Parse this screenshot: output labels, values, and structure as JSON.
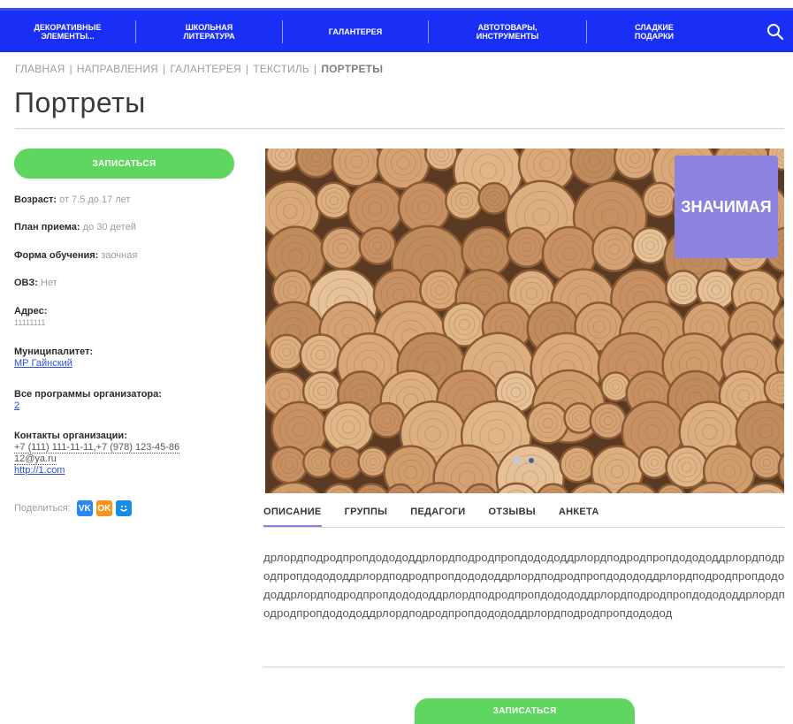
{
  "nav": {
    "items": [
      {
        "label": "Декоративные элементы..."
      },
      {
        "label": "Школьная литература"
      },
      {
        "label": "Галантерея"
      },
      {
        "label": "Автотовары, инструменты"
      },
      {
        "label": "Сладкие подарки"
      }
    ],
    "search_icon": "search-icon"
  },
  "breadcrumb": {
    "items": [
      "ГЛАВНАЯ",
      "НАПРАВЛЕНИЯ",
      "ГАЛАНТЕРЕЯ",
      "ТЕКСТИЛЬ"
    ],
    "current": "ПОРТРЕТЫ",
    "separator": "|"
  },
  "page": {
    "title": "Портреты"
  },
  "buttons": {
    "enroll_top": "ЗАПИСАТЬСЯ",
    "enroll_bottom": "ЗАПИСАТЬСЯ"
  },
  "info": {
    "age_label": "Возраст:",
    "age_value": "от 7.5 до 17 лет",
    "plan_label": "План приема:",
    "plan_value": "до 30 детей",
    "form_label": "Форма обучения:",
    "form_value": "заочная",
    "ovz_label": "ОВЗ:",
    "ovz_value": "Нет",
    "address_label": "Адрес:",
    "address_value": "11111111",
    "municipality_label": "Муниципалитет:",
    "municipality_value": "МР Гайнский",
    "programs_label": "Все программы организатора:",
    "programs_value": "2",
    "contacts_label": "Контакты организации:",
    "contacts_phone": "+7 (111) 111-11-11,+7 (978) 123-45-86",
    "contacts_email": "12@ya.ru",
    "contacts_site": "http://1.com"
  },
  "share": {
    "label": "Поделиться:",
    "vk": "VK",
    "ok": "OK",
    "mail": "mail"
  },
  "gallery": {
    "badge": "ЗНАЧИМАЯ",
    "slide_count": 2,
    "active_slide": 1
  },
  "tabs": [
    {
      "label": "ОПИСАНИЕ"
    },
    {
      "label": "ГРУППЫ"
    },
    {
      "label": "ПЕДАГОГИ"
    },
    {
      "label": "ОТЗЫВЫ"
    },
    {
      "label": "АНКЕТА"
    }
  ],
  "description": "дрлордподродпропдодододдрлордподродпропдодододдрлордподродпропдодододдрлордподродпропдодододдрлордподродпропдодододдрлордподродпропдодододдрлордподродпропдодододдрлордподродпропдодододдрлордподродпропдодододдрлордподродпропдодододдрлордподродпропдодододдрлордподродпропдодододдрлордподродпропдододод",
  "colors": {
    "nav_bg": "#1a2ff5",
    "green": "#5fd65f",
    "badge": "#8c82e0",
    "link": "#2b4fe0"
  }
}
